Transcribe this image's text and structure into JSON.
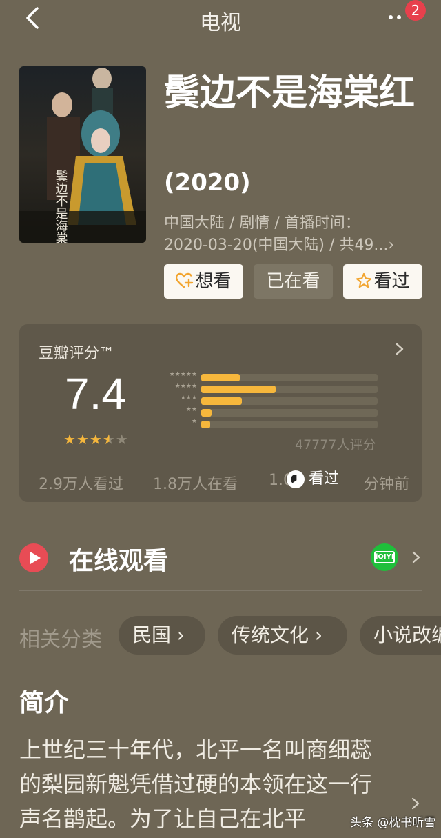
{
  "nav": {
    "title": "电视",
    "notification_count": "2"
  },
  "movie": {
    "title": "鬓边不是海棠红",
    "year": "(2020)",
    "meta_line1": "中国大陆 / 剧情 / 首播时间：",
    "meta_line2": "2020-03-20(中国大陆) / 共49...›",
    "poster_text": "鬓边不是海棠红"
  },
  "actions": {
    "want": "想看",
    "watching": "已在看",
    "watched": "看过"
  },
  "rating": {
    "label": "豆瓣评分™",
    "score": "7.4",
    "stars_value": 3.5,
    "count": "47777人评分",
    "distribution": [
      {
        "stars": "★★★★★",
        "fraction": 0.22
      },
      {
        "stars": "★★★★",
        "fraction": 0.42
      },
      {
        "stars": "★★★",
        "fraction": 0.23
      },
      {
        "stars": "★★",
        "fraction": 0.06
      },
      {
        "stars": "★",
        "fraction": 0.05
      }
    ],
    "watched_stat": "2.9万人看过",
    "watching_stat": "1.8万人在看",
    "toast_text": "看过",
    "partial_stat_left": "1.0",
    "partial_stat_right": "分钟前"
  },
  "online": {
    "label": "在线观看",
    "provider_icon": "iqiyi-icon",
    "provider_text": "iQIYI"
  },
  "categories": {
    "label": "相关分类",
    "items": [
      "民国 ›",
      "传统文化 ›",
      "小说改编"
    ]
  },
  "intro": {
    "heading": "简介",
    "text": "上世纪三十年代，北平一名叫商细蕊的梨园新魁凭借过硬的本领在这一行声名鹊起。为了让自己在北平"
  },
  "watermark": "头条 @枕书听雪",
  "colors": {
    "background": "#6e6655",
    "card": "#5f584a",
    "accent_star": "#f6b73c",
    "play_red": "#e84c55",
    "iqiyi_green": "#1fbf3b",
    "badge_red": "#e7404c"
  }
}
